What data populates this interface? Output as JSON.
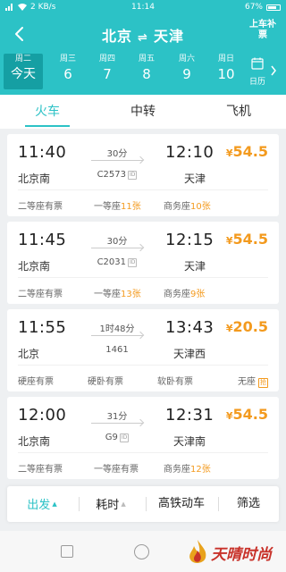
{
  "status_bar": {
    "network": "2 KB/s",
    "time": "11:14",
    "battery": "67%"
  },
  "header": {
    "origin": "北京",
    "swap_icon": "⇌",
    "destination": "天津",
    "upgrade_label": "上车补票"
  },
  "dates": [
    {
      "weekday": "周二",
      "day": "今天",
      "selected": true
    },
    {
      "weekday": "周三",
      "day": "6"
    },
    {
      "weekday": "周四",
      "day": "7"
    },
    {
      "weekday": "周五",
      "day": "8"
    },
    {
      "weekday": "周六",
      "day": "9"
    },
    {
      "weekday": "周日",
      "day": "10"
    }
  ],
  "calendar_label": "日历",
  "mode_tabs": [
    "火车",
    "中转",
    "飞机"
  ],
  "trains": [
    {
      "dep_time": "11:40",
      "arr_time": "12:10",
      "price": "54.5",
      "duration": "30分",
      "dep_station": "北京南",
      "train_no": "C2573",
      "id_tag": "ID",
      "arr_station": "天津",
      "seats": [
        {
          "label": "二等座有票",
          "count": ""
        },
        {
          "label": "一等座",
          "count": "11张"
        },
        {
          "label": "商务座",
          "count": "10张"
        }
      ]
    },
    {
      "dep_time": "11:45",
      "arr_time": "12:15",
      "price": "54.5",
      "duration": "30分",
      "dep_station": "北京南",
      "train_no": "C2031",
      "id_tag": "ID",
      "arr_station": "天津",
      "seats": [
        {
          "label": "二等座有票",
          "count": ""
        },
        {
          "label": "一等座",
          "count": "13张"
        },
        {
          "label": "商务座",
          "count": "9张"
        }
      ]
    },
    {
      "dep_time": "11:55",
      "arr_time": "13:43",
      "price": "20.5",
      "duration": "1时48分",
      "dep_station": "北京",
      "train_no": "1461",
      "arr_station": "天津西",
      "seats": [
        {
          "label": "硬座有票",
          "count": ""
        },
        {
          "label": "硬卧有票",
          "count": ""
        },
        {
          "label": "软卧有票",
          "count": ""
        },
        {
          "label": "无座",
          "count": "",
          "tag": "抢"
        }
      ]
    },
    {
      "dep_time": "12:00",
      "arr_time": "12:31",
      "price": "54.5",
      "duration": "31分",
      "dep_station": "北京南",
      "train_no": "G9",
      "id_tag": "ID",
      "arr_station": "天津南",
      "seats": [
        {
          "label": "二等座有票",
          "count": ""
        },
        {
          "label": "一等座有票",
          "count": ""
        },
        {
          "label": "商务座",
          "count": "12张"
        }
      ]
    }
  ],
  "currency_symbol": "¥",
  "sort_bar": {
    "depart": "出发",
    "duration": "耗时",
    "hsr": "高铁动车",
    "filter": "筛选"
  },
  "watermark_text": "天晴时尚",
  "colors": {
    "accent": "#2cc2c6",
    "price": "#f39a1e",
    "watermark": "#c8322a"
  }
}
